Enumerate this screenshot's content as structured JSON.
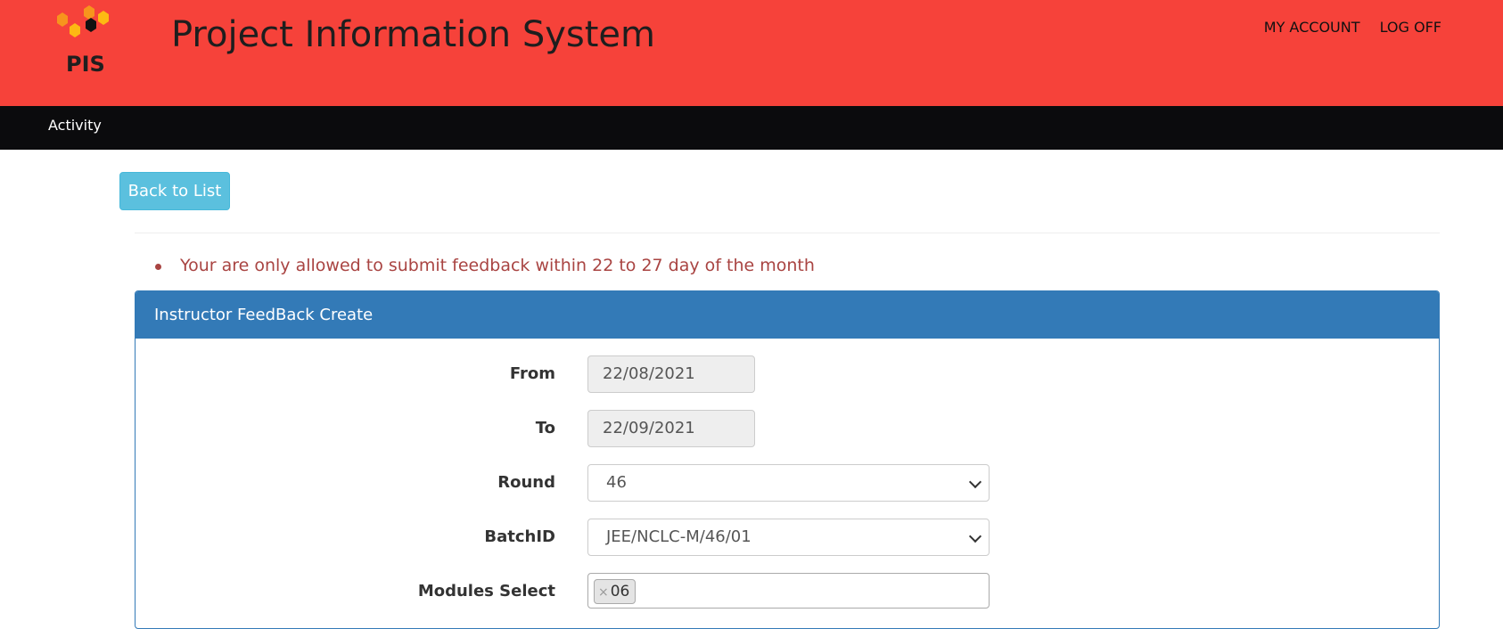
{
  "header": {
    "logo_text": "PIS",
    "title": "Project Information System",
    "links": [
      "MY ACCOUNT",
      "LOG OFF"
    ]
  },
  "nav": {
    "items": [
      "Activity"
    ]
  },
  "actions": {
    "back_label": "Back to List"
  },
  "alert": {
    "message": "Your are only allowed to submit feedback within 22 to 27 day of the month"
  },
  "panel": {
    "title": "Instructor FeedBack Create",
    "fields": {
      "from": {
        "label": "From",
        "value": "22/08/2021"
      },
      "to": {
        "label": "To",
        "value": "22/09/2021"
      },
      "round": {
        "label": "Round",
        "value": "46"
      },
      "batch": {
        "label": "BatchID",
        "value": "JEE/NCLC-M/46/01"
      },
      "modules": {
        "label": "Modules Select",
        "chips": [
          "06"
        ],
        "remove_symbol": "×"
      }
    }
  },
  "colors": {
    "header_bg": "#f6423a",
    "nav_bg": "#0b0b0d",
    "back_button_bg": "#5bc0de",
    "panel_heading_bg": "#337ab7",
    "alert_text": "#a94442",
    "logo_cells": [
      "#f7941d",
      "#fdb913",
      "#111111",
      "#f7941d",
      "#fdb913"
    ]
  }
}
